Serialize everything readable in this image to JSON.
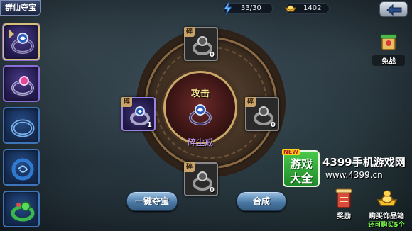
{
  "header": {
    "title": "群仙夺宝",
    "energy": "33/30",
    "gold": "1402"
  },
  "items": [
    {
      "name": "ring-1",
      "color": "purple",
      "selected": true
    },
    {
      "name": "ring-2",
      "color": "purple",
      "selected": false
    },
    {
      "name": "ring-3",
      "color": "blue",
      "selected": false
    },
    {
      "name": "ring-4",
      "color": "blue",
      "selected": false
    },
    {
      "name": "ring-5",
      "color": "blue",
      "selected": false
    }
  ],
  "center": {
    "attack_label": "攻击",
    "item_name": "碎尘戒"
  },
  "fragments": {
    "tag": "碎",
    "top": {
      "count": "0",
      "owned": false
    },
    "left": {
      "count": "1",
      "owned": true
    },
    "right": {
      "count": "0",
      "owned": false
    },
    "bottom": {
      "count": "0",
      "owned": false
    }
  },
  "buttons": {
    "snatch": "一键夺宝",
    "combine": "合成"
  },
  "right_panel": {
    "free_war": "免战",
    "reward": "奖励",
    "buy_box": "购买饰品箱",
    "buy_box_sub": "还可购买5个"
  },
  "watermark": {
    "badge": "NEW",
    "logo_line1": "游戏",
    "logo_line2": "大全",
    "site_name": "4399手机游戏网",
    "url": "www.4399.cn"
  },
  "colors": {
    "accent_gold": "#c9a86a",
    "purple_rarity": "#8a6ed8",
    "blue_rarity": "#3e74b8",
    "name_purple": "#c9a0ff"
  }
}
